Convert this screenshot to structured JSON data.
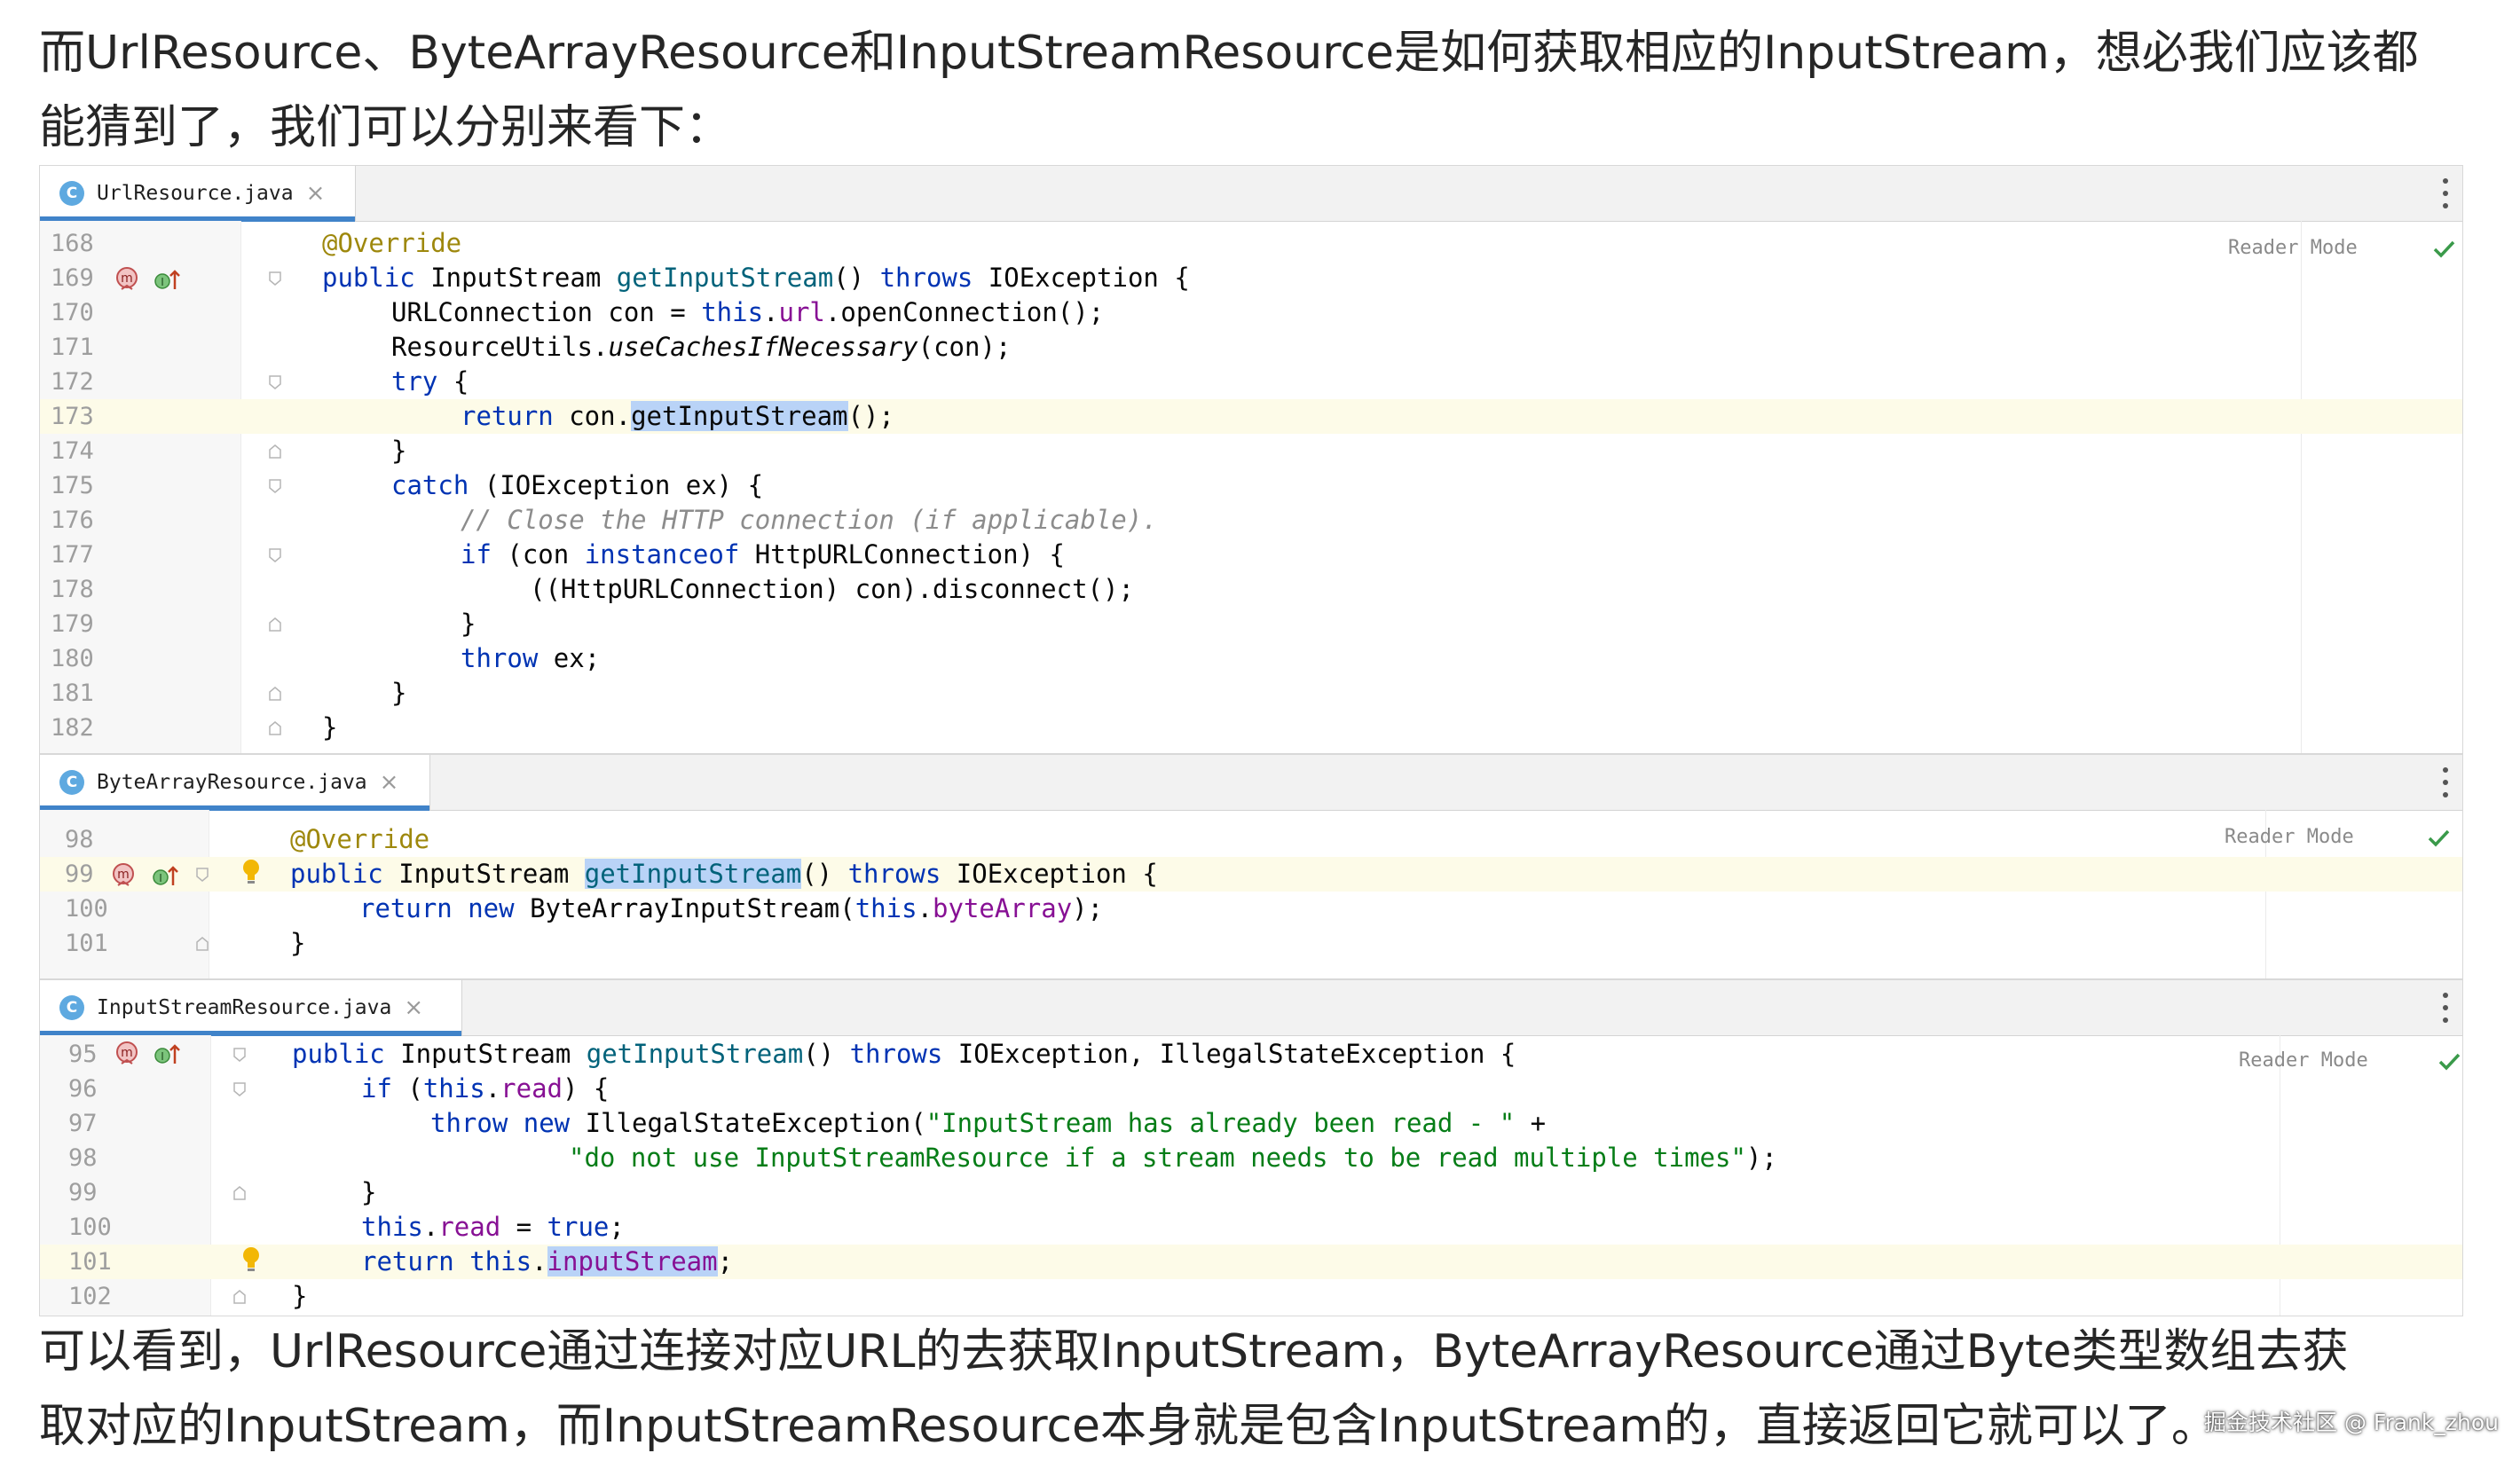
{
  "intro": {
    "line1": "而UrlResource、ByteArrayResource和InputStreamResource是如何获取相应的InputStream，想必我们应该都",
    "line2": "能猜到了，我们可以分别来看下："
  },
  "outro": {
    "line1": "可以看到，UrlResource通过连接对应URL的去获取InputStream，ByteArrayResource通过Byte类型数组去获",
    "line2": "取对应的InputStream，而InputStreamResource本身就是包含InputStream的，直接返回它就可以了。"
  },
  "watermark": "掘金技术社区 @ Frank_zhou",
  "editor_common": {
    "reader_mode": "Reader Mode",
    "class_icon_letter": "C",
    "close_glyph": "×",
    "method_icon_letter": "m"
  },
  "panels": [
    {
      "file": "UrlResource.java",
      "lines": [
        {
          "n": "168",
          "text": "@Override"
        },
        {
          "n": "169",
          "text": "public InputStream getInputStream() throws IOException {"
        },
        {
          "n": "170",
          "text": "URLConnection con = this.url.openConnection();"
        },
        {
          "n": "171",
          "text": "ResourceUtils.useCachesIfNecessary(con);"
        },
        {
          "n": "172",
          "text": "try {"
        },
        {
          "n": "173",
          "text": "return con.getInputStream();"
        },
        {
          "n": "174",
          "text": "}"
        },
        {
          "n": "175",
          "text": "catch (IOException ex) {"
        },
        {
          "n": "176",
          "text": "// Close the HTTP connection (if applicable)."
        },
        {
          "n": "177",
          "text": "if (con instanceof HttpURLConnection) {"
        },
        {
          "n": "178",
          "text": "((HttpURLConnection) con).disconnect();"
        },
        {
          "n": "179",
          "text": "}"
        },
        {
          "n": "180",
          "text": "throw ex;"
        },
        {
          "n": "181",
          "text": "}"
        },
        {
          "n": "182",
          "text": "}"
        }
      ]
    },
    {
      "file": "ByteArrayResource.java",
      "lines": [
        {
          "n": "98",
          "text": "@Override"
        },
        {
          "n": "99",
          "text": "public InputStream getInputStream() throws IOException {"
        },
        {
          "n": "100",
          "text": "return new ByteArrayInputStream(this.byteArray);"
        },
        {
          "n": "101",
          "text": "}"
        }
      ]
    },
    {
      "file": "InputStreamResource.java",
      "lines": [
        {
          "n": "95",
          "text": "public InputStream getInputStream() throws IOException, IllegalStateException {"
        },
        {
          "n": "96",
          "text": "if (this.read) {"
        },
        {
          "n": "97",
          "text": "throw new IllegalStateException(\"InputStream has already been read - \" +"
        },
        {
          "n": "98",
          "text": "\"do not use InputStreamResource if a stream needs to be read multiple times\");"
        },
        {
          "n": "99",
          "text": "}"
        },
        {
          "n": "100",
          "text": "this.read = true;"
        },
        {
          "n": "101",
          "text": "return this.inputStream;"
        },
        {
          "n": "102",
          "text": "}"
        }
      ]
    }
  ]
}
